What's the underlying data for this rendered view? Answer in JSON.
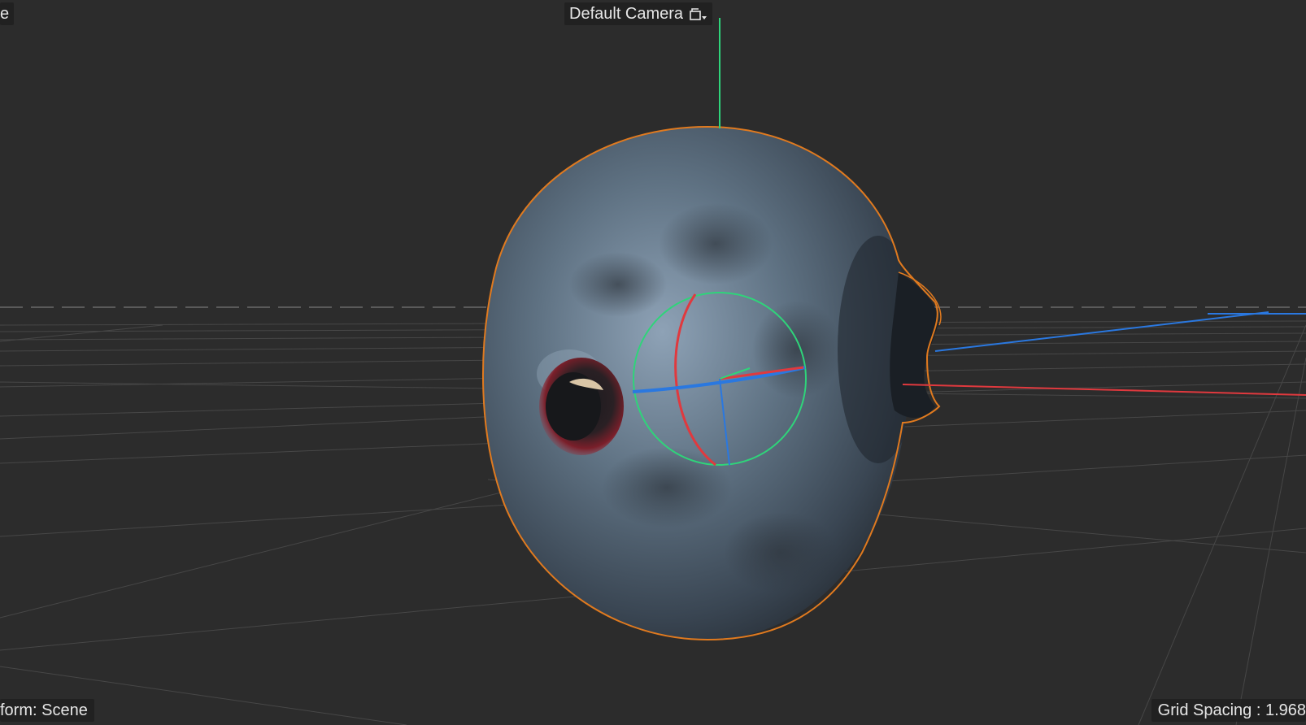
{
  "viewport": {
    "camera_label": "Default Camera",
    "top_left_fragment": "e",
    "transform_label": "form: Scene",
    "grid_spacing_label": "Grid Spacing : 1.968",
    "camera_icon": "camera-menu-icon"
  },
  "colors": {
    "background": "#2c2c2c",
    "grid_line": "#4a4a4a",
    "selection_outline": "#e07a1f",
    "axis_x": "#e0393e",
    "axis_y": "#2fd47a",
    "axis_z": "#2a78e0",
    "sphere_base": "#5c6e80"
  }
}
